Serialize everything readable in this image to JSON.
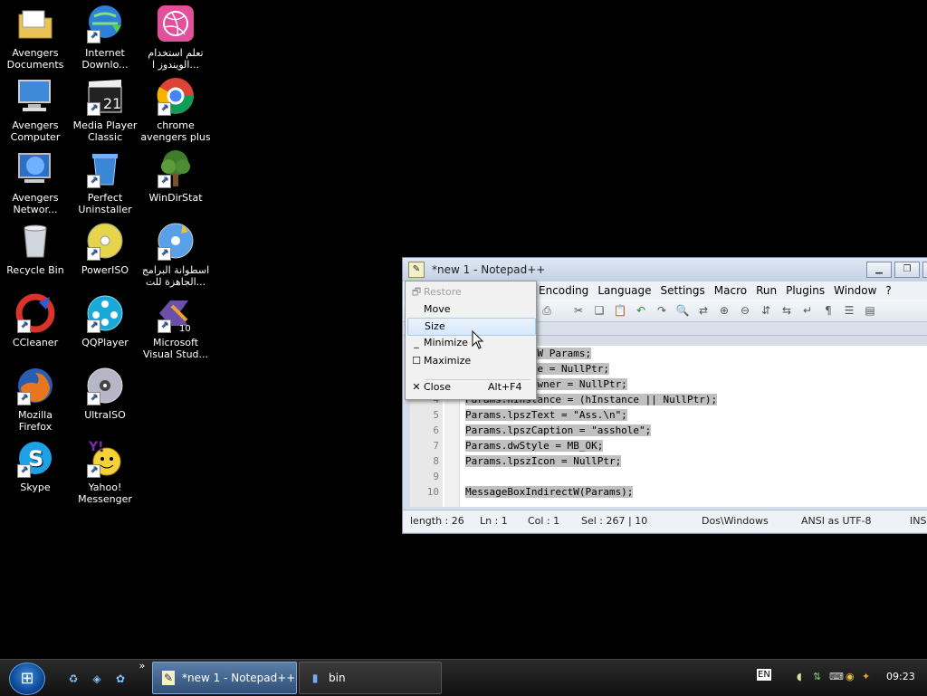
{
  "desktop": {
    "icons": [
      {
        "name": "avengers-documents-icon",
        "label": "Avengers\nDocuments"
      },
      {
        "name": "internet-download-icon",
        "label": "Internet\nDownlo..."
      },
      {
        "name": "learn-windows-icon",
        "label": "تعلم استخدام\nالويندوز ا..."
      },
      {
        "name": "avengers-computer-icon",
        "label": "Avengers\nComputer"
      },
      {
        "name": "media-player-classic-icon",
        "label": "Media Player\nClassic"
      },
      {
        "name": "chrome-icon",
        "label": "chrome\navengers plus"
      },
      {
        "name": "avengers-network-icon",
        "label": "Avengers\nNetwor..."
      },
      {
        "name": "perfect-uninstaller-icon",
        "label": "Perfect\nUninstaller"
      },
      {
        "name": "windirstat-icon",
        "label": "WinDirStat"
      },
      {
        "name": "recycle-bin-icon",
        "label": "Recycle Bin"
      },
      {
        "name": "poweriso-icon",
        "label": "PowerISO"
      },
      {
        "name": "ready-programs-disc-icon",
        "label": "اسطوانة البرامج\nالجاهزة للت..."
      },
      {
        "name": "ccleaner-icon",
        "label": "CCleaner"
      },
      {
        "name": "qqplayer-icon",
        "label": "QQPlayer"
      },
      {
        "name": "visual-studio-icon",
        "label": "Microsoft\nVisual Stud..."
      },
      {
        "name": "firefox-icon",
        "label": "Mozilla\nFirefox"
      },
      {
        "name": "ultraiso-icon",
        "label": "UltraISO"
      },
      {
        "name": "skype-icon",
        "label": "Skype"
      },
      {
        "name": "yahoo-messenger-icon",
        "label": "Yahoo!\nMessenger"
      }
    ]
  },
  "npp": {
    "title": "*new  1 - Notepad++",
    "menu": [
      "Encoding",
      "Language",
      "Settings",
      "Macro",
      "Run",
      "Plugins",
      "Window",
      "?"
    ],
    "line_numbers": [
      "",
      "",
      "",
      "4",
      "5",
      "6",
      "7",
      "8",
      "9",
      "10"
    ],
    "code": [
      "MSGBOXPARAMSW Params;",
      "Params.cbSize = NullPtr;",
      "Params.hwndOwner = NullPtr;",
      "Params.hInstance = (hInstance || NullPtr);",
      "Params.lpszText = \"Ass.\\n\";",
      "Params.lpszCaption = \"asshole\";",
      "Params.dwStyle = MB_OK;",
      "Params.lpszIcon = NullPtr;",
      "",
      "MessageBoxIndirectW(Params);"
    ],
    "status": {
      "length": "length : 26",
      "ln": "Ln : 1",
      "col": "Col : 1",
      "sel": "Sel : 267 | 10",
      "eol": "Dos\\Windows",
      "encoding": "ANSI as UTF-8",
      "mode": "INS"
    }
  },
  "sysmenu": {
    "restore": "Restore",
    "move": "Move",
    "size": "Size",
    "minimize": "Minimize",
    "maximize": "Maximize",
    "close": "Close",
    "close_shortcut": "Alt+F4"
  },
  "taskbar": {
    "tasks": [
      {
        "label": "*new  1 - Notepad++"
      },
      {
        "label": "bin"
      }
    ],
    "lang": "EN",
    "clock": "09:23"
  }
}
